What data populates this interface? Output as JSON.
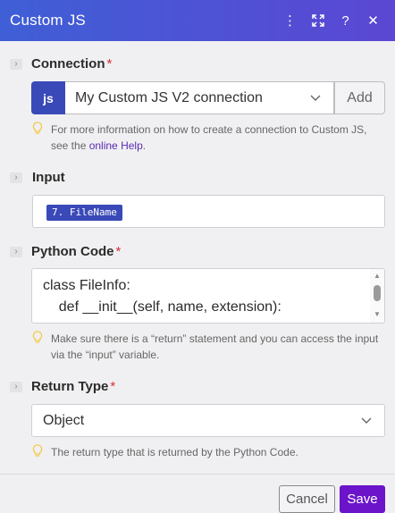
{
  "header": {
    "title": "Custom JS",
    "icons": [
      "more-vertical-icon",
      "expand-icon",
      "help-icon",
      "close-icon"
    ],
    "icon_glyphs": [
      "⋮",
      "⤢",
      "?",
      "✕"
    ]
  },
  "connection": {
    "label": "Connection",
    "required_mark": "*",
    "badge": "js",
    "selected": "My Custom JS V2 connection",
    "add_label": "Add",
    "hint_prefix": "For more information on how to create a connection to Custom JS, see the ",
    "hint_link": "online Help",
    "hint_suffix": "."
  },
  "input": {
    "label": "Input",
    "pill": "7. FileName"
  },
  "python_code": {
    "label": "Python Code",
    "required_mark": "*",
    "lines": [
      "class FileInfo:",
      "    def __init__(self, name, extension):"
    ],
    "hint": "Make sure there is a “return” statement and you can access the input via the “input” variable."
  },
  "return_type": {
    "label": "Return Type",
    "required_mark": "*",
    "selected": "Object",
    "hint": "The return type that is returned by the Python Code."
  },
  "footer": {
    "cancel_label": "Cancel",
    "save_label": "Save"
  },
  "colors": {
    "header_start": "#3f5fd6",
    "header_end": "#5b47d3",
    "accent": "#3a49b8",
    "save": "#6b14c9",
    "required": "#d0323a",
    "link": "#5a2bb0",
    "bulb": "#f2c94c"
  }
}
